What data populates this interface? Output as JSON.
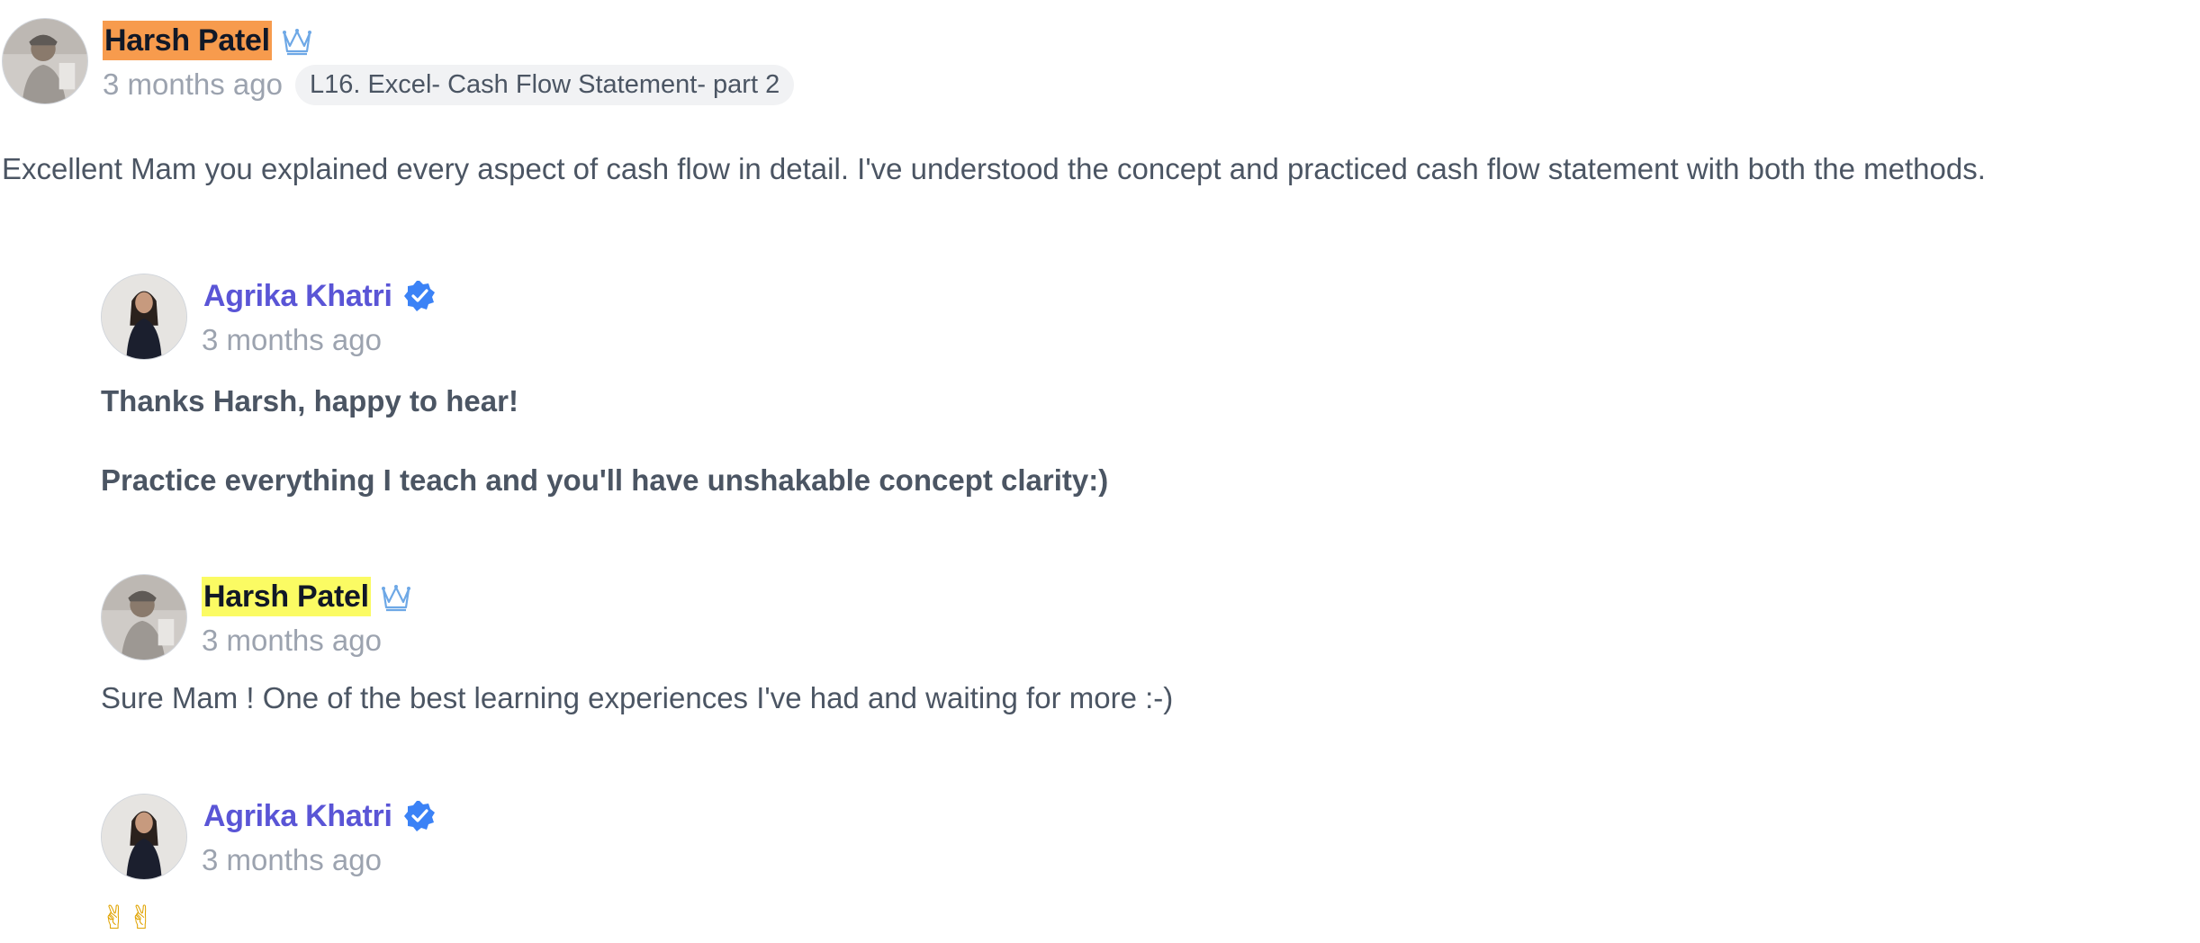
{
  "thread": {
    "root": {
      "author": "Harsh Patel",
      "time": "3 months ago",
      "lesson": "L16. Excel- Cash Flow Statement- part 2",
      "text": "Excellent Mam you explained every aspect of cash flow in detail. I've understood the concept and practiced cash flow statement with both the methods.",
      "badge_icon": "crown-icon"
    },
    "replies": [
      {
        "author": "Agrika Khatri",
        "time": "3 months ago",
        "badge_icon": "verified-icon",
        "line1": "Thanks Harsh, happy to hear!",
        "line2": "Practice everything I teach and you'll have unshakable concept clarity:)"
      },
      {
        "author": "Harsh Patel",
        "time": "3 months ago",
        "badge_icon": "crown-icon",
        "text": "Sure Mam ! One of the best learning experiences I've had and waiting for more :-)"
      },
      {
        "author": "Agrika Khatri",
        "time": "3 months ago",
        "badge_icon": "verified-icon",
        "text": "✌✌"
      }
    ]
  },
  "colors": {
    "teacher_name": "#5a55d6",
    "highlight_orange": "#f79b4d",
    "highlight_yellow": "#fbfb63",
    "verified_blue": "#3b82f6",
    "muted_text": "#9ca3af"
  }
}
